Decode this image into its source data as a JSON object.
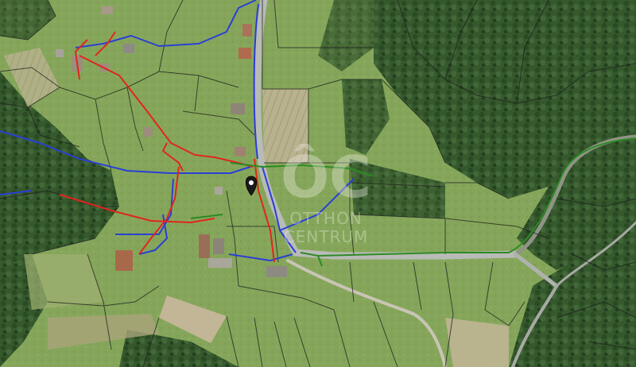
{
  "map": {
    "type": "aerial-cadastral",
    "watermark": {
      "logo": "ÔC",
      "line1": "OTTHON",
      "line2": "CENTRUM"
    },
    "marker": {
      "icon": "map-pin-icon"
    },
    "layers": [
      {
        "name": "parcel-boundaries",
        "color": "#1e1e1e"
      },
      {
        "name": "blue-utility-line",
        "color": "#2a3fd6"
      },
      {
        "name": "red-utility-line",
        "color": "#e0261d"
      },
      {
        "name": "green-utility-line",
        "color": "#2d8a24"
      }
    ],
    "colors": {
      "forest": "#2f5128",
      "meadow": "#86a65c",
      "field": "#b7b28f",
      "road": "#b9bbb7"
    }
  }
}
